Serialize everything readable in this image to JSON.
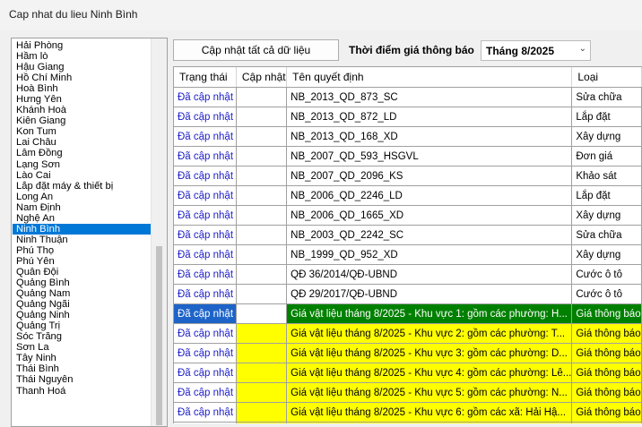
{
  "window": {
    "title": "Cap nhat du lieu Ninh Bình"
  },
  "provinces": {
    "items": [
      "Hải Phòng",
      "Hầm lò",
      "Hậu Giang",
      "Hồ Chí Minh",
      "Hoà Bình",
      "Hưng Yên",
      "Khánh Hoà",
      "Kiên Giang",
      "Kon Tum",
      "Lai Châu",
      "Lâm Đồng",
      "Lạng Sơn",
      "Lào Cai",
      "Lắp đặt máy & thiết bị",
      "Long An",
      "Nam Định",
      "Nghệ An",
      "Ninh Bình",
      "Ninh Thuận",
      "Phú Thọ",
      "Phú Yên",
      "Quân Đội",
      "Quảng Bình",
      "Quảng Nam",
      "Quảng Ngãi",
      "Quảng Ninh",
      "Quảng Trị",
      "Sóc Trăng",
      "Sơn La",
      "Tây Ninh",
      "Thái Bình",
      "Thái Nguyên",
      "Thanh Hoá"
    ],
    "selected_index": 17
  },
  "toolbar": {
    "update_all_label": "Cập nhật tất cả dữ liệu",
    "time_label": "Thời điểm giá thông báo",
    "period_value": "Tháng 8/2025"
  },
  "grid": {
    "headers": [
      "Trạng thái",
      "Cập nhật",
      "Tên quyết định",
      "Loại"
    ],
    "rows": [
      {
        "status": "Đã cập nhật",
        "update": "",
        "name": "NB_2013_QD_873_SC",
        "type": "Sửa chữa",
        "style": ""
      },
      {
        "status": "Đã cập nhật",
        "update": "",
        "name": "NB_2013_QD_872_LD",
        "type": "Lắp đặt",
        "style": ""
      },
      {
        "status": "Đã cập nhật",
        "update": "",
        "name": "NB_2013_QD_168_XD",
        "type": "Xây dựng",
        "style": ""
      },
      {
        "status": "Đã cập nhật",
        "update": "",
        "name": "NB_2007_QD_593_HSGVL",
        "type": "Đơn giá",
        "style": ""
      },
      {
        "status": "Đã cập nhật",
        "update": "",
        "name": "NB_2007_QD_2096_KS",
        "type": "Khảo sát",
        "style": ""
      },
      {
        "status": "Đã cập nhật",
        "update": "",
        "name": "NB_2006_QD_2246_LD",
        "type": "Lắp đặt",
        "style": ""
      },
      {
        "status": "Đã cập nhật",
        "update": "",
        "name": "NB_2006_QD_1665_XD",
        "type": "Xây dựng",
        "style": ""
      },
      {
        "status": "Đã cập nhật",
        "update": "",
        "name": "NB_2003_QD_2242_SC",
        "type": "Sửa chữa",
        "style": ""
      },
      {
        "status": "Đã cập nhật",
        "update": "",
        "name": "NB_1999_QD_952_XD",
        "type": "Xây dựng",
        "style": ""
      },
      {
        "status": "Đã cập nhật",
        "update": "",
        "name": "QĐ 36/2014/QĐ-UBND",
        "type": "Cước ô tô",
        "style": ""
      },
      {
        "status": "Đã cập nhật",
        "update": "",
        "name": "QĐ 29/2017/QĐ-UBND",
        "type": "Cước ô tô",
        "style": ""
      },
      {
        "status": "Đã cập nhật",
        "update": "",
        "name": "Giá vật liệu tháng 8/2025 - Khu vực 1: gồm các phường: H...",
        "type": "Giá thông báo",
        "style": "sel"
      },
      {
        "status": "Đã cập nhật",
        "update": "",
        "name": "Giá vật liệu tháng 8/2025 - Khu vực 2: gồm các phường: T...",
        "type": "Giá thông báo",
        "style": "hl"
      },
      {
        "status": "Đã cập nhật",
        "update": "",
        "name": "Giá vật liệu tháng 8/2025 - Khu vực 3: gồm các phường: D...",
        "type": "Giá thông báo",
        "style": "hl"
      },
      {
        "status": "Đã cập nhật",
        "update": "",
        "name": "Giá vật liệu tháng 8/2025 - Khu vực 4: gồm các phường: Lê...",
        "type": "Giá thông báo",
        "style": "hl"
      },
      {
        "status": "Đã cập nhật",
        "update": "",
        "name": "Giá vật liệu tháng 8/2025 - Khu vực 5: gồm các phường: N...",
        "type": "Giá thông báo",
        "style": "hl"
      },
      {
        "status": "Đã cập nhật",
        "update": "",
        "name": "Giá vật liệu tháng 8/2025 - Khu vực 6: gồm các xã: Hải Hậ...",
        "type": "Giá thông báo",
        "style": "hl"
      },
      {
        "status": "",
        "update": "",
        "name": "",
        "type": "",
        "style": "hl"
      }
    ]
  },
  "colors": {
    "selection_blue": "#0078d7",
    "status_link": "#1c1cc8",
    "selected_row_green": "#008000",
    "highlight_yellow": "#ffff00"
  },
  "icons": {
    "dropdown": "chevron-down-icon"
  }
}
